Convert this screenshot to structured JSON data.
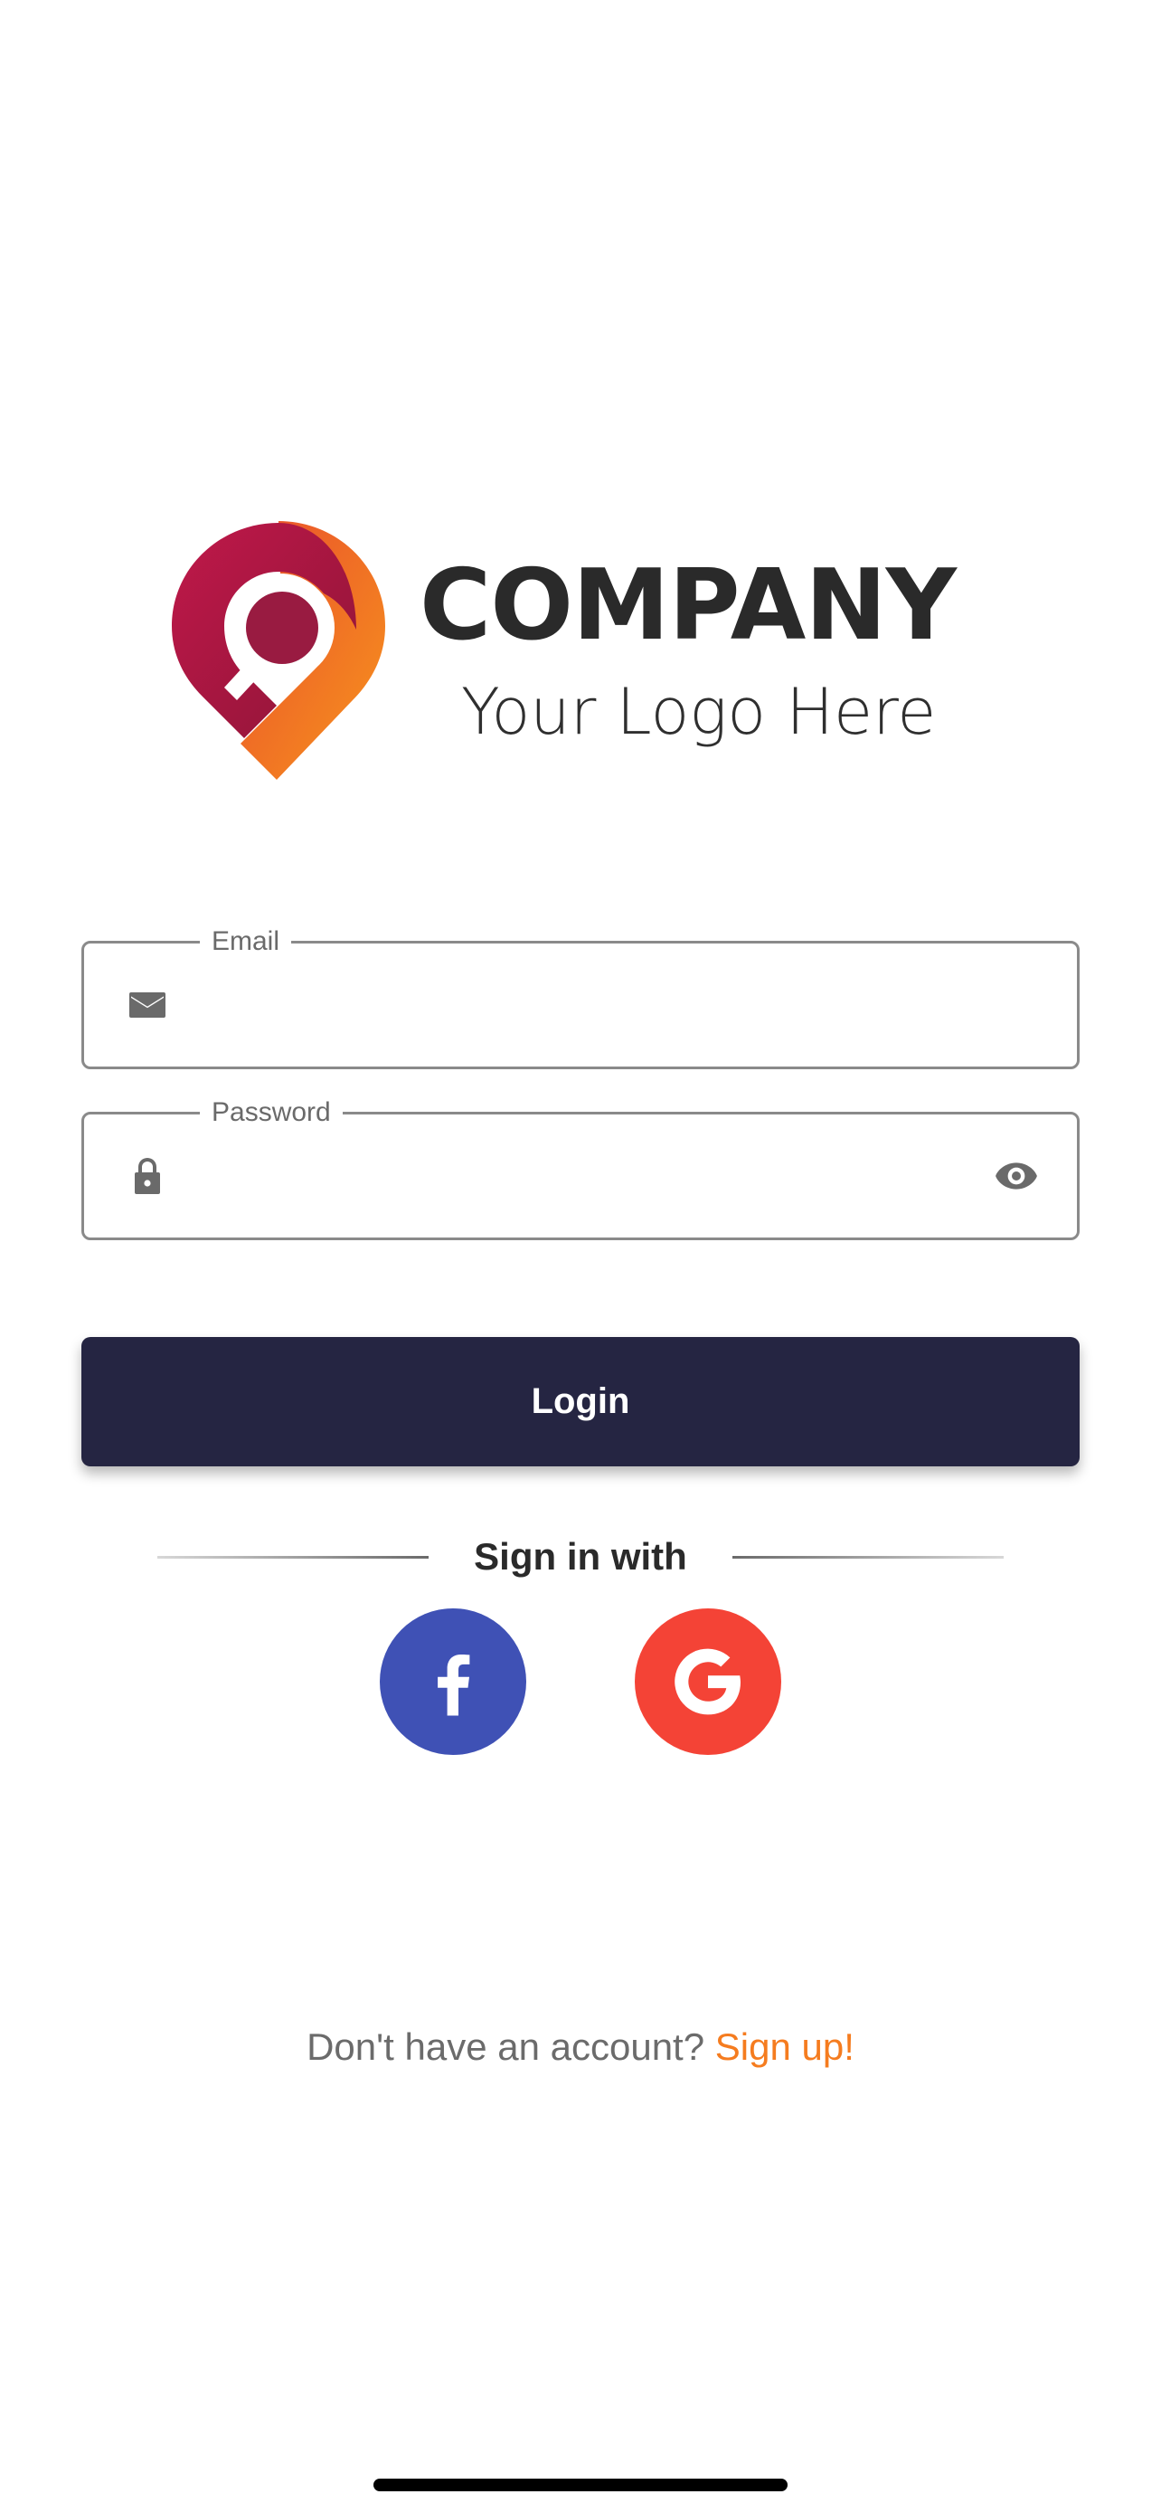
{
  "logo": {
    "company": "COMPANY",
    "tagline": "Your Logo Here"
  },
  "form": {
    "email": {
      "label": "Email",
      "value": "",
      "icon": "mail-icon"
    },
    "password": {
      "label": "Password",
      "value": "",
      "icon": "lock-icon",
      "toggle_icon": "eye-icon"
    },
    "login_label": "Login"
  },
  "social": {
    "divider_text": "Sign in with",
    "providers": [
      {
        "name": "facebook",
        "icon": "facebook-icon",
        "color": "#3f51b5"
      },
      {
        "name": "google",
        "icon": "google-icon",
        "color": "#f44336"
      }
    ]
  },
  "signup": {
    "prompt": "Don't have an account?",
    "link": "Sign up!"
  },
  "colors": {
    "primary": "#252542",
    "accent": "#f57c1f",
    "logo_dark": "#9b1b40",
    "facebook": "#3f51b5",
    "google": "#f44336",
    "field_border": "#8a8a8a",
    "muted_text": "#6b6b6b"
  }
}
